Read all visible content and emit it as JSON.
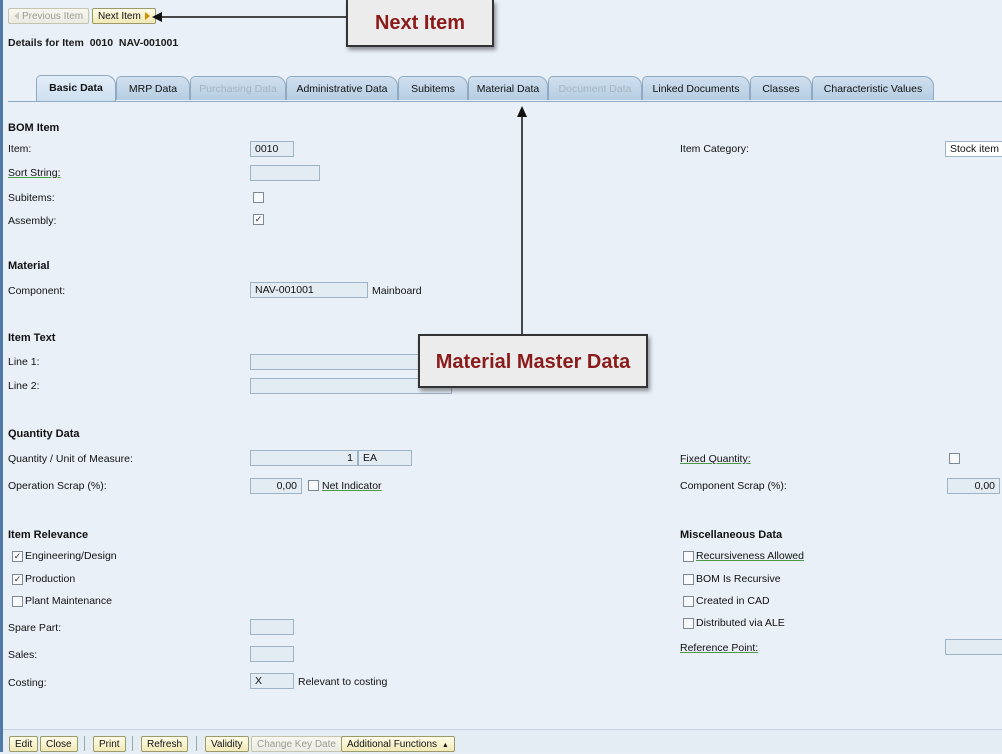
{
  "header": {
    "prev_item": "Previous Item",
    "next_item": "Next Item",
    "details_title": "Details for Item  0010  NAV-001001"
  },
  "tabs": [
    {
      "label": "Basic Data",
      "state": "active"
    },
    {
      "label": "MRP Data",
      "state": "enabled"
    },
    {
      "label": "Purchasing Data",
      "state": "disabled"
    },
    {
      "label": "Administrative Data",
      "state": "enabled"
    },
    {
      "label": "Subitems",
      "state": "enabled"
    },
    {
      "label": "Material Data",
      "state": "enabled"
    },
    {
      "label": "Document Data",
      "state": "disabled"
    },
    {
      "label": "Linked Documents",
      "state": "enabled"
    },
    {
      "label": "Classes",
      "state": "enabled"
    },
    {
      "label": "Characteristic Values",
      "state": "enabled"
    }
  ],
  "bom_item": {
    "title": "BOM Item",
    "item_label": "Item:",
    "item_value": "0010",
    "sort_string_label": "Sort String:",
    "subitems_label": "Subitems:",
    "subitems_checked": false,
    "assembly_label": "Assembly:",
    "assembly_checked": true,
    "item_category_label": "Item Category:",
    "item_category_value": "Stock item"
  },
  "material": {
    "title": "Material",
    "component_label": "Component:",
    "component_value": "NAV-001001",
    "component_desc": "Mainboard"
  },
  "item_text": {
    "title": "Item Text",
    "line1_label": "Line 1:",
    "line2_label": "Line 2:"
  },
  "quantity": {
    "title": "Quantity Data",
    "qty_label": "Quantity / Unit of Measure:",
    "qty_value": "1",
    "uom_value": "EA",
    "op_scrap_label": "Operation Scrap (%):",
    "op_scrap_value": "0,00",
    "net_indicator_label": "Net Indicator",
    "fixed_qty_label": "Fixed Quantity:",
    "comp_scrap_label": "Component Scrap (%):",
    "comp_scrap_value": "0,00"
  },
  "relevance": {
    "title": "Item Relevance",
    "engineering": "Engineering/Design",
    "production": "Production",
    "plant_maintenance": "Plant Maintenance",
    "spare_part_label": "Spare Part:",
    "sales_label": "Sales:",
    "costing_label": "Costing:",
    "costing_value": "X",
    "costing_desc": "Relevant to costing"
  },
  "misc": {
    "title": "Miscellaneous Data",
    "recursiveness": "Recursiveness Allowed",
    "bom_recursive": "BOM Is Recursive",
    "created_cad": "Created in CAD",
    "distributed_ale": "Distributed via ALE",
    "reference_point_label": "Reference Point:"
  },
  "toolbar": {
    "edit": "Edit",
    "close": "Close",
    "print": "Print",
    "refresh": "Refresh",
    "validity": "Validity",
    "change_key_date": "Change Key Date",
    "additional_functions": "Additional Functions"
  },
  "callouts": {
    "next_item": "Next Item",
    "material_master": "Material Master Data"
  }
}
